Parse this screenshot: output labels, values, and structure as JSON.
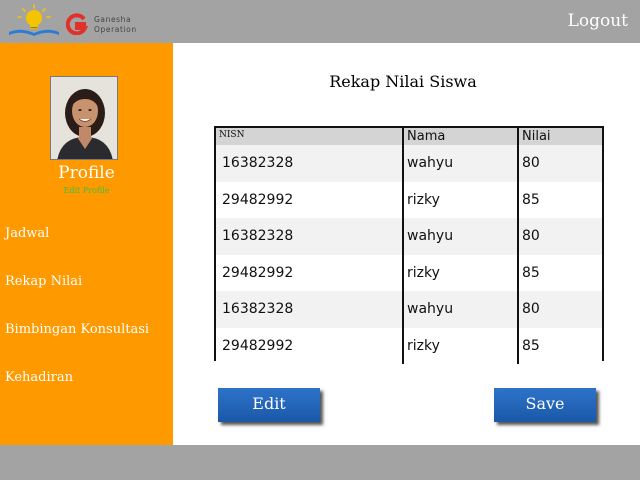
{
  "header": {
    "brand_line1": "Ganesha",
    "brand_line2": "Operation",
    "logout_label": "Logout",
    "colors": {
      "bar": "#a3a3a3",
      "logo_bulb": "#f5c400",
      "logo_book": "#2e7bd6",
      "logo_g": "#e0322b"
    },
    "icons": [
      "lightbulb-book-logo-icon",
      "g-logo-icon"
    ]
  },
  "sidebar": {
    "profile_title": "Profile",
    "edit_profile": "Edit Profile",
    "items": [
      {
        "label": "Jadwal"
      },
      {
        "label": "Rekap Nilai"
      },
      {
        "label": "Bimbingan Konsultasi"
      },
      {
        "label": "Kehadiran"
      }
    ],
    "colors": {
      "background": "#ff9900",
      "edit_link": "#3fbf3f"
    }
  },
  "main": {
    "title": "Rekap Nilai Siswa",
    "table": {
      "headers": [
        "NISN",
        "Nama",
        "Nilai"
      ],
      "rows": [
        [
          "16382328",
          "wahyu",
          "80"
        ],
        [
          "29482992",
          "rizky",
          "85"
        ],
        [
          "16382328",
          "wahyu",
          "80"
        ],
        [
          "29482992",
          "rizky",
          "85"
        ],
        [
          "16382328",
          "wahyu",
          "80"
        ],
        [
          "29482992",
          "rizky",
          "85"
        ]
      ]
    },
    "buttons": {
      "edit": "Edit",
      "save": "Save"
    },
    "colors": {
      "button": "#1f63b8"
    }
  }
}
